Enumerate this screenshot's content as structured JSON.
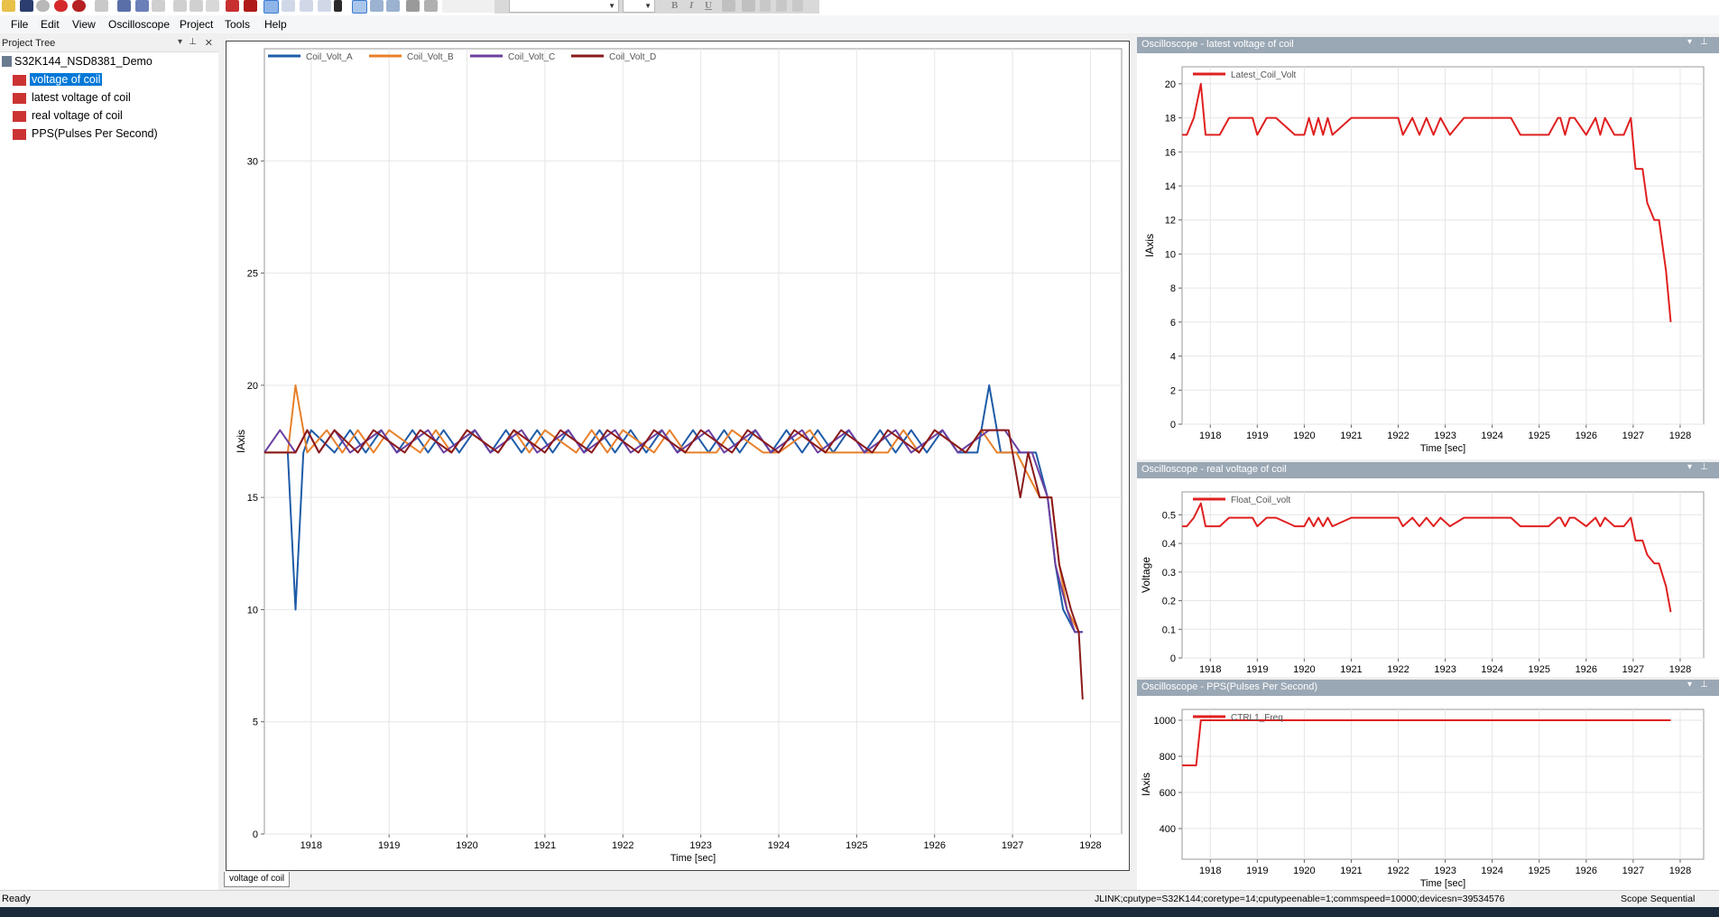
{
  "menu": [
    "File",
    "Edit",
    "View",
    "Oscilloscope",
    "Project",
    "Tools",
    "Help"
  ],
  "tree": {
    "title": "Project Tree",
    "root": "S32K144_NSD8381_Demo",
    "items": [
      "voltage of coil",
      "latest voltage of coil",
      "real voltage of coil",
      "PPS(Pulses Per Second)"
    ],
    "selected_index": 0
  },
  "doc_tab": "voltage of coil",
  "status": {
    "left": "Ready",
    "connection": "JLINK;cputype=S32K144;coretype=14;cputypeenable=1;commspeed=10000;devicesn=39534576",
    "right": "Scope Sequential"
  },
  "icons": [
    "open-folder-icon",
    "save-icon",
    "disk-icon",
    "record-icon",
    "copy-icon",
    "paste-icon",
    "undo-icon",
    "redo-icon",
    "zoom-icon",
    "arrow-up-icon",
    "arrow-down-icon",
    "bold-icon",
    "italic-icon",
    "underline-icon",
    "align-left-icon",
    "align-center-icon",
    "align-right-icon"
  ],
  "chart_data": [
    {
      "type": "line",
      "xlabel": "Time [sec]",
      "ylabel": "IAxis",
      "xlim": [
        1917.4,
        1928.4
      ],
      "ylim": [
        0,
        35
      ],
      "xticks": [
        1918,
        1919,
        1920,
        1921,
        1922,
        1923,
        1924,
        1925,
        1926,
        1927,
        1928
      ],
      "yticks": [
        0,
        5,
        10,
        15,
        20,
        25,
        30
      ],
      "grid": true,
      "legend": "top-left",
      "series": [
        {
          "name": "Coil_Volt_A",
          "color": "#1f5ba8",
          "x": [
            1917.4,
            1917.7,
            1917.8,
            1917.9,
            1918.0,
            1918.3,
            1918.5,
            1918.7,
            1918.9,
            1919.1,
            1919.3,
            1919.5,
            1919.7,
            1919.9,
            1920.1,
            1920.3,
            1920.5,
            1920.7,
            1920.9,
            1921.1,
            1921.3,
            1921.5,
            1921.7,
            1921.9,
            1922.1,
            1922.3,
            1922.5,
            1922.7,
            1922.9,
            1923.1,
            1923.3,
            1923.5,
            1923.7,
            1923.9,
            1924.1,
            1924.3,
            1924.5,
            1924.7,
            1924.9,
            1925.1,
            1925.3,
            1925.5,
            1925.7,
            1925.9,
            1926.1,
            1926.3,
            1926.55,
            1926.7,
            1926.85,
            1927.05,
            1927.3,
            1927.45,
            1927.55,
            1927.65,
            1927.8,
            1927.9
          ],
          "values": [
            17,
            17,
            10,
            17,
            18,
            17,
            18,
            17,
            18,
            17,
            18,
            17,
            18,
            17,
            18,
            17,
            18,
            17,
            18,
            17,
            18,
            17,
            18,
            17,
            18,
            17,
            18,
            17,
            18,
            17,
            18,
            17,
            18,
            17,
            18,
            17,
            18,
            17,
            18,
            17,
            18,
            17,
            18,
            17,
            18,
            17,
            17,
            20,
            17,
            17,
            17,
            15,
            12,
            10,
            9,
            9
          ]
        },
        {
          "name": "Coil_Volt_B",
          "color": "#e8802a",
          "x": [
            1917.4,
            1917.7,
            1917.8,
            1917.95,
            1918.2,
            1918.4,
            1918.6,
            1918.8,
            1919.0,
            1919.4,
            1919.6,
            1919.8,
            1920.0,
            1920.4,
            1920.6,
            1920.8,
            1921.0,
            1921.4,
            1921.6,
            1921.8,
            1922.0,
            1922.4,
            1922.6,
            1922.8,
            1923.2,
            1923.4,
            1923.8,
            1924.0,
            1924.4,
            1924.6,
            1925.0,
            1925.4,
            1925.6,
            1925.8,
            1926.0,
            1926.4,
            1926.6,
            1926.8,
            1927.05,
            1927.35,
            1927.5,
            1927.6,
            1927.7,
            1927.85
          ],
          "values": [
            17,
            17,
            20,
            17,
            18,
            17,
            18,
            17,
            18,
            17,
            18,
            17,
            18,
            17,
            18,
            17,
            18,
            17,
            18,
            17,
            18,
            17,
            18,
            17,
            17,
            18,
            17,
            17,
            18,
            17,
            17,
            17,
            18,
            17,
            18,
            17,
            18,
            17,
            17,
            15,
            15,
            12,
            10,
            9
          ]
        },
        {
          "name": "Coil_Volt_C",
          "color": "#6a3fa0",
          "x": [
            1917.4,
            1917.6,
            1917.8,
            1917.95,
            1918.1,
            1918.3,
            1918.5,
            1918.9,
            1919.1,
            1919.5,
            1919.7,
            1920.1,
            1920.3,
            1920.7,
            1920.9,
            1921.3,
            1921.5,
            1921.9,
            1922.1,
            1922.5,
            1922.7,
            1923.1,
            1923.3,
            1923.7,
            1923.9,
            1924.3,
            1924.5,
            1924.9,
            1925.1,
            1925.5,
            1925.7,
            1926.1,
            1926.3,
            1926.7,
            1926.9,
            1927.1,
            1927.25,
            1927.45,
            1927.55,
            1927.7,
            1927.8,
            1927.9
          ],
          "values": [
            17,
            18,
            17,
            18,
            17,
            18,
            17,
            18,
            17,
            18,
            17,
            18,
            17,
            18,
            17,
            18,
            17,
            18,
            17,
            18,
            17,
            18,
            17,
            18,
            17,
            18,
            17,
            18,
            17,
            18,
            17,
            18,
            17,
            18,
            18,
            17,
            17,
            15,
            12,
            10,
            9,
            9
          ]
        },
        {
          "name": "Coil_Volt_D",
          "color": "#8b1a1a",
          "x": [
            1917.4,
            1917.8,
            1917.95,
            1918.1,
            1918.3,
            1918.6,
            1918.8,
            1919.2,
            1919.4,
            1919.8,
            1920.0,
            1920.4,
            1920.6,
            1921.0,
            1921.2,
            1921.6,
            1921.8,
            1922.2,
            1922.4,
            1922.8,
            1923.0,
            1923.4,
            1923.6,
            1924.0,
            1924.2,
            1924.6,
            1924.8,
            1925.2,
            1925.4,
            1925.8,
            1926.0,
            1926.4,
            1926.6,
            1926.95,
            1927.1,
            1927.2,
            1927.35,
            1927.5,
            1927.6,
            1927.75,
            1927.85,
            1927.9
          ],
          "values": [
            17,
            17,
            18,
            17,
            18,
            17,
            18,
            17,
            18,
            17,
            18,
            17,
            18,
            17,
            18,
            17,
            18,
            17,
            18,
            17,
            18,
            17,
            18,
            17,
            18,
            17,
            18,
            17,
            18,
            17,
            18,
            17,
            18,
            18,
            15,
            17,
            15,
            15,
            12,
            10,
            9,
            6
          ]
        }
      ]
    },
    {
      "type": "line",
      "title": "Oscilloscope - latest voltage of coil",
      "xlabel": "Time [sec]",
      "ylabel": "IAxis",
      "xlim": [
        1917.4,
        1928.5
      ],
      "ylim": [
        0,
        21
      ],
      "xticks": [
        1918,
        1919,
        1920,
        1921,
        1922,
        1923,
        1924,
        1925,
        1926,
        1927,
        1928
      ],
      "yticks": [
        0,
        2,
        4,
        6,
        8,
        10,
        12,
        14,
        16,
        18,
        20
      ],
      "grid": true,
      "legend": "top-left",
      "series": [
        {
          "name": "Latest_Coil_Volt",
          "color": "#e02020",
          "x": [
            1917.4,
            1917.5,
            1917.65,
            1917.8,
            1917.9,
            1918.2,
            1918.4,
            1918.9,
            1919.0,
            1919.2,
            1919.4,
            1919.8,
            1920.0,
            1920.1,
            1920.2,
            1920.3,
            1920.4,
            1920.5,
            1920.6,
            1921.0,
            1921.2,
            1922.0,
            1922.1,
            1922.3,
            1922.45,
            1922.6,
            1922.75,
            1922.9,
            1923.1,
            1923.4,
            1924.4,
            1924.6,
            1925.2,
            1925.4,
            1925.45,
            1925.55,
            1925.65,
            1925.75,
            1926.0,
            1926.2,
            1926.3,
            1926.4,
            1926.6,
            1926.8,
            1926.95,
            1927.05,
            1927.2,
            1927.3,
            1927.45,
            1927.55,
            1927.7,
            1927.8
          ],
          "values": [
            17,
            17,
            18,
            20,
            17,
            17,
            18,
            18,
            17,
            18,
            18,
            17,
            17,
            18,
            17,
            18,
            17,
            18,
            17,
            18,
            18,
            18,
            17,
            18,
            17,
            18,
            17,
            18,
            17,
            18,
            18,
            17,
            17,
            18,
            18,
            17,
            18,
            18,
            17,
            18,
            17,
            18,
            17,
            17,
            18,
            15,
            15,
            13,
            12,
            12,
            9,
            6
          ]
        }
      ]
    },
    {
      "type": "line",
      "title": "Oscilloscope - real voltage of coil",
      "xlabel": "Time [sec]",
      "ylabel": "Voltage",
      "xlim": [
        1917.4,
        1928.5
      ],
      "ylim": [
        0,
        0.58
      ],
      "xticks": [
        1918,
        1919,
        1920,
        1921,
        1922,
        1923,
        1924,
        1925,
        1926,
        1927,
        1928
      ],
      "yticks": [
        0,
        0.1,
        0.2,
        0.3,
        0.4,
        0.5
      ],
      "grid": true,
      "legend": "top-left",
      "series": [
        {
          "name": "Float_Coil_volt",
          "color": "#e02020",
          "x": [
            1917.4,
            1917.5,
            1917.65,
            1917.8,
            1917.9,
            1918.2,
            1918.4,
            1918.9,
            1919.0,
            1919.2,
            1919.4,
            1919.8,
            1920.0,
            1920.1,
            1920.2,
            1920.3,
            1920.4,
            1920.5,
            1920.6,
            1921.0,
            1921.2,
            1922.0,
            1922.1,
            1922.3,
            1922.45,
            1922.6,
            1922.75,
            1922.9,
            1923.1,
            1923.4,
            1924.4,
            1924.6,
            1925.2,
            1925.4,
            1925.45,
            1925.55,
            1925.65,
            1925.75,
            1926.0,
            1926.2,
            1926.3,
            1926.4,
            1926.6,
            1926.8,
            1926.95,
            1927.05,
            1927.2,
            1927.3,
            1927.45,
            1927.55,
            1927.7,
            1927.8
          ],
          "values": [
            0.46,
            0.46,
            0.49,
            0.54,
            0.46,
            0.46,
            0.49,
            0.49,
            0.46,
            0.49,
            0.49,
            0.46,
            0.46,
            0.49,
            0.46,
            0.49,
            0.46,
            0.49,
            0.46,
            0.49,
            0.49,
            0.49,
            0.46,
            0.49,
            0.46,
            0.49,
            0.46,
            0.49,
            0.46,
            0.49,
            0.49,
            0.46,
            0.46,
            0.49,
            0.49,
            0.46,
            0.49,
            0.49,
            0.46,
            0.49,
            0.46,
            0.49,
            0.46,
            0.46,
            0.49,
            0.41,
            0.41,
            0.36,
            0.33,
            0.33,
            0.25,
            0.16
          ]
        }
      ]
    },
    {
      "type": "line",
      "title": "Oscilloscope - PPS(Pulses Per Second)",
      "xlabel": "Time [sec]",
      "ylabel": "IAxis",
      "xlim": [
        1917.4,
        1928.5
      ],
      "ylim": [
        230,
        1060
      ],
      "xticks": [
        1918,
        1919,
        1920,
        1921,
        1922,
        1923,
        1924,
        1925,
        1926,
        1927,
        1928
      ],
      "yticks": [
        400,
        600,
        800,
        1000
      ],
      "grid": true,
      "legend": "top-left",
      "series": [
        {
          "name": "CTRL1_Freq",
          "color": "#e02020",
          "x": [
            1917.4,
            1917.7,
            1917.8,
            1927.8
          ],
          "values": [
            750,
            750,
            1000,
            1000
          ]
        }
      ]
    }
  ]
}
